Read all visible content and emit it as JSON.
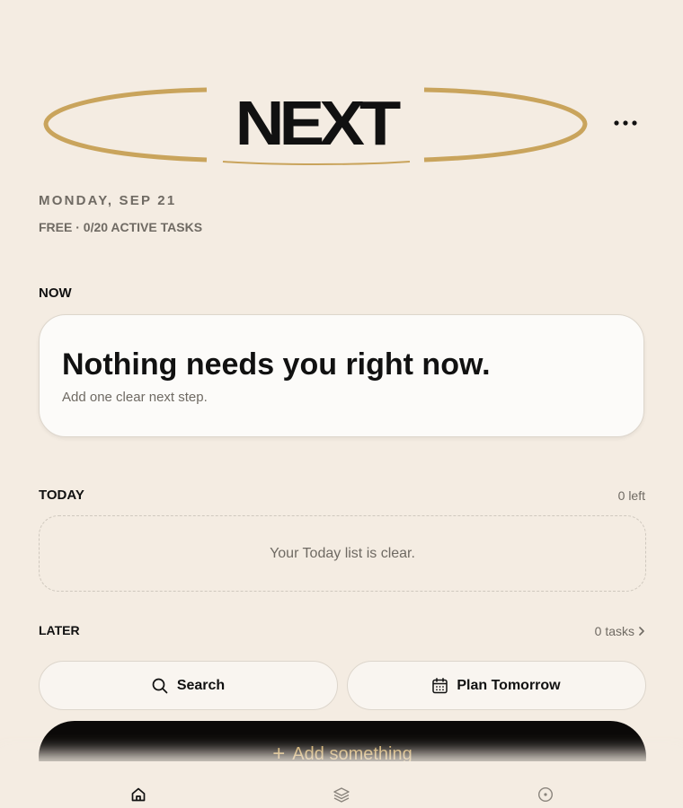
{
  "header": {
    "logo_text": "NEXT",
    "more_label": "•••"
  },
  "meta": {
    "date": "MONDAY, SEP 21",
    "plan": "FREE · 0/20 ACTIVE TASKS"
  },
  "now": {
    "title": "NOW",
    "heading": "Nothing needs you right now.",
    "subtext": "Add one clear next step."
  },
  "today": {
    "title": "TODAY",
    "count": "0 left",
    "empty_text": "Your Today list is clear."
  },
  "later": {
    "title": "LATER",
    "count": "0 tasks"
  },
  "actions": {
    "search_label": "Search",
    "plan_label": "Plan Tomorrow",
    "add_label": "Add something"
  },
  "tabs": [
    {
      "icon": "home-icon"
    },
    {
      "icon": "layers-icon"
    },
    {
      "icon": "target-icon"
    }
  ],
  "colors": {
    "background": "#f4ece2",
    "accent_gold": "#c9a45c",
    "card": "#fcfbf9",
    "muted_text": "#6f6a63",
    "dark_button": "#0b0908"
  }
}
